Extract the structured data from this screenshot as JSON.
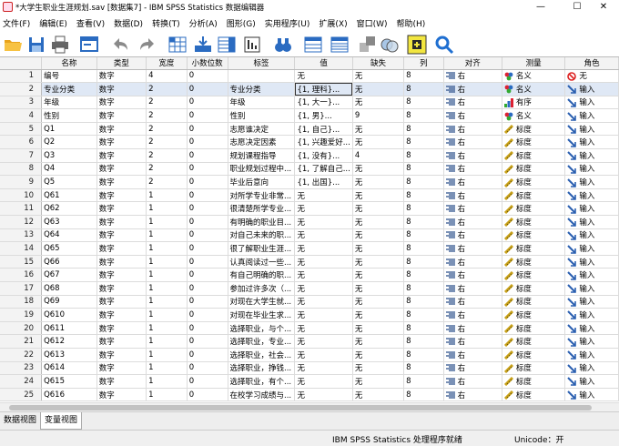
{
  "title": "*大学生职业生涯规划.sav [数据集7] - IBM SPSS Statistics 数据编辑器",
  "window_controls": {
    "minimize": "—",
    "maximize": "☐",
    "close": "✕"
  },
  "menu": [
    "文件(F)",
    "编辑(E)",
    "查看(V)",
    "数据(D)",
    "转换(T)",
    "分析(A)",
    "图形(G)",
    "实用程序(U)",
    "扩展(X)",
    "窗口(W)",
    "帮助(H)"
  ],
  "columns": [
    "名称",
    "类型",
    "宽度",
    "小数位数",
    "标签",
    "值",
    "缺失",
    "列",
    "对齐",
    "测量",
    "角色"
  ],
  "rows": [
    {
      "n": "1",
      "name": "编号",
      "type": "数字",
      "width": "4",
      "dec": "0",
      "label": "",
      "value": "无",
      "missing": "无",
      "cols": "8",
      "align": "右",
      "measure": "名义",
      "measure_kind": "nominal",
      "role": "无",
      "role_kind": "none"
    },
    {
      "n": "2",
      "name": "专业分类",
      "type": "数字",
      "width": "2",
      "dec": "0",
      "label": "专业分类",
      "value": "{1, 理科}...",
      "missing": "无",
      "cols": "8",
      "align": "右",
      "measure": "名义",
      "measure_kind": "nominal",
      "role": "输入",
      "role_kind": "input"
    },
    {
      "n": "3",
      "name": "年级",
      "type": "数字",
      "width": "2",
      "dec": "0",
      "label": "年级",
      "value": "{1, 大一}...",
      "missing": "无",
      "cols": "8",
      "align": "右",
      "measure": "有序",
      "measure_kind": "ordinal",
      "role": "输入",
      "role_kind": "input"
    },
    {
      "n": "4",
      "name": "性别",
      "type": "数字",
      "width": "2",
      "dec": "0",
      "label": "性别",
      "value": "{1, 男}...",
      "missing": "9",
      "cols": "8",
      "align": "右",
      "measure": "名义",
      "measure_kind": "nominal",
      "role": "输入",
      "role_kind": "input"
    },
    {
      "n": "5",
      "name": "Q1",
      "type": "数字",
      "width": "2",
      "dec": "0",
      "label": "志愿谁决定",
      "value": "{1, 自己}...",
      "missing": "无",
      "cols": "8",
      "align": "右",
      "measure": "标度",
      "measure_kind": "scale",
      "role": "输入",
      "role_kind": "input"
    },
    {
      "n": "6",
      "name": "Q2",
      "type": "数字",
      "width": "2",
      "dec": "0",
      "label": "志愿决定因素",
      "value": "{1, 兴趣爱好...",
      "missing": "无",
      "cols": "8",
      "align": "右",
      "measure": "标度",
      "measure_kind": "scale",
      "role": "输入",
      "role_kind": "input"
    },
    {
      "n": "7",
      "name": "Q3",
      "type": "数字",
      "width": "2",
      "dec": "0",
      "label": "规划课程指导",
      "value": "{1, 没有}...",
      "missing": "4",
      "cols": "8",
      "align": "右",
      "measure": "标度",
      "measure_kind": "scale",
      "role": "输入",
      "role_kind": "input"
    },
    {
      "n": "8",
      "name": "Q4",
      "type": "数字",
      "width": "2",
      "dec": "0",
      "label": "职业规划过程中...",
      "value": "{1, 了解自己...",
      "missing": "无",
      "cols": "8",
      "align": "右",
      "measure": "标度",
      "measure_kind": "scale",
      "role": "输入",
      "role_kind": "input"
    },
    {
      "n": "9",
      "name": "Q5",
      "type": "数字",
      "width": "2",
      "dec": "0",
      "label": "毕业后意向",
      "value": "{1, 出国}...",
      "missing": "无",
      "cols": "8",
      "align": "右",
      "measure": "标度",
      "measure_kind": "scale",
      "role": "输入",
      "role_kind": "input"
    },
    {
      "n": "10",
      "name": "Q61",
      "type": "数字",
      "width": "1",
      "dec": "0",
      "label": "对所学专业非常...",
      "value": "无",
      "missing": "无",
      "cols": "8",
      "align": "右",
      "measure": "标度",
      "measure_kind": "scale",
      "role": "输入",
      "role_kind": "input"
    },
    {
      "n": "11",
      "name": "Q62",
      "type": "数字",
      "width": "1",
      "dec": "0",
      "label": "很清楚所学专业...",
      "value": "无",
      "missing": "无",
      "cols": "8",
      "align": "右",
      "measure": "标度",
      "measure_kind": "scale",
      "role": "输入",
      "role_kind": "input"
    },
    {
      "n": "12",
      "name": "Q63",
      "type": "数字",
      "width": "1",
      "dec": "0",
      "label": "有明确的职业目...",
      "value": "无",
      "missing": "无",
      "cols": "8",
      "align": "右",
      "measure": "标度",
      "measure_kind": "scale",
      "role": "输入",
      "role_kind": "input"
    },
    {
      "n": "13",
      "name": "Q64",
      "type": "数字",
      "width": "1",
      "dec": "0",
      "label": "对自己未来的职...",
      "value": "无",
      "missing": "无",
      "cols": "8",
      "align": "右",
      "measure": "标度",
      "measure_kind": "scale",
      "role": "输入",
      "role_kind": "input"
    },
    {
      "n": "14",
      "name": "Q65",
      "type": "数字",
      "width": "1",
      "dec": "0",
      "label": "很了解职业生涯...",
      "value": "无",
      "missing": "无",
      "cols": "8",
      "align": "右",
      "measure": "标度",
      "measure_kind": "scale",
      "role": "输入",
      "role_kind": "input"
    },
    {
      "n": "15",
      "name": "Q66",
      "type": "数字",
      "width": "1",
      "dec": "0",
      "label": "认真阅读过一些...",
      "value": "无",
      "missing": "无",
      "cols": "8",
      "align": "右",
      "measure": "标度",
      "measure_kind": "scale",
      "role": "输入",
      "role_kind": "input"
    },
    {
      "n": "16",
      "name": "Q67",
      "type": "数字",
      "width": "1",
      "dec": "0",
      "label": "有自己明确的职...",
      "value": "无",
      "missing": "无",
      "cols": "8",
      "align": "右",
      "measure": "标度",
      "measure_kind": "scale",
      "role": "输入",
      "role_kind": "input"
    },
    {
      "n": "17",
      "name": "Q68",
      "type": "数字",
      "width": "1",
      "dec": "0",
      "label": "参加过许多次（...",
      "value": "无",
      "missing": "无",
      "cols": "8",
      "align": "右",
      "measure": "标度",
      "measure_kind": "scale",
      "role": "输入",
      "role_kind": "input"
    },
    {
      "n": "18",
      "name": "Q69",
      "type": "数字",
      "width": "1",
      "dec": "0",
      "label": "对现在大学生就...",
      "value": "无",
      "missing": "无",
      "cols": "8",
      "align": "右",
      "measure": "标度",
      "measure_kind": "scale",
      "role": "输入",
      "role_kind": "input"
    },
    {
      "n": "19",
      "name": "Q610",
      "type": "数字",
      "width": "1",
      "dec": "0",
      "label": "对现在毕业生求...",
      "value": "无",
      "missing": "无",
      "cols": "8",
      "align": "右",
      "measure": "标度",
      "measure_kind": "scale",
      "role": "输入",
      "role_kind": "input"
    },
    {
      "n": "20",
      "name": "Q611",
      "type": "数字",
      "width": "1",
      "dec": "0",
      "label": "选择职业，与个...",
      "value": "无",
      "missing": "无",
      "cols": "8",
      "align": "右",
      "measure": "标度",
      "measure_kind": "scale",
      "role": "输入",
      "role_kind": "input"
    },
    {
      "n": "21",
      "name": "Q612",
      "type": "数字",
      "width": "1",
      "dec": "0",
      "label": "选择职业，专业...",
      "value": "无",
      "missing": "无",
      "cols": "8",
      "align": "右",
      "measure": "标度",
      "measure_kind": "scale",
      "role": "输入",
      "role_kind": "input"
    },
    {
      "n": "22",
      "name": "Q613",
      "type": "数字",
      "width": "1",
      "dec": "0",
      "label": "选择职业，社会...",
      "value": "无",
      "missing": "无",
      "cols": "8",
      "align": "右",
      "measure": "标度",
      "measure_kind": "scale",
      "role": "输入",
      "role_kind": "input"
    },
    {
      "n": "23",
      "name": "Q614",
      "type": "数字",
      "width": "1",
      "dec": "0",
      "label": "选择职业，挣钱...",
      "value": "无",
      "missing": "无",
      "cols": "8",
      "align": "右",
      "measure": "标度",
      "measure_kind": "scale",
      "role": "输入",
      "role_kind": "input"
    },
    {
      "n": "24",
      "name": "Q615",
      "type": "数字",
      "width": "1",
      "dec": "0",
      "label": "选择职业，有个...",
      "value": "无",
      "missing": "无",
      "cols": "8",
      "align": "右",
      "measure": "标度",
      "measure_kind": "scale",
      "role": "输入",
      "role_kind": "input"
    },
    {
      "n": "25",
      "name": "Q616",
      "type": "数字",
      "width": "1",
      "dec": "0",
      "label": "在校学习成绩与...",
      "value": "无",
      "missing": "无",
      "cols": "8",
      "align": "右",
      "measure": "标度",
      "measure_kind": "scale",
      "role": "输入",
      "role_kind": "input"
    }
  ],
  "tabs": [
    "数据视图",
    "变量视图"
  ],
  "active_tab": "变量视图",
  "status": {
    "processor": "IBM SPSS Statistics 处理程序就绪",
    "unicode": "Unicode：开"
  }
}
